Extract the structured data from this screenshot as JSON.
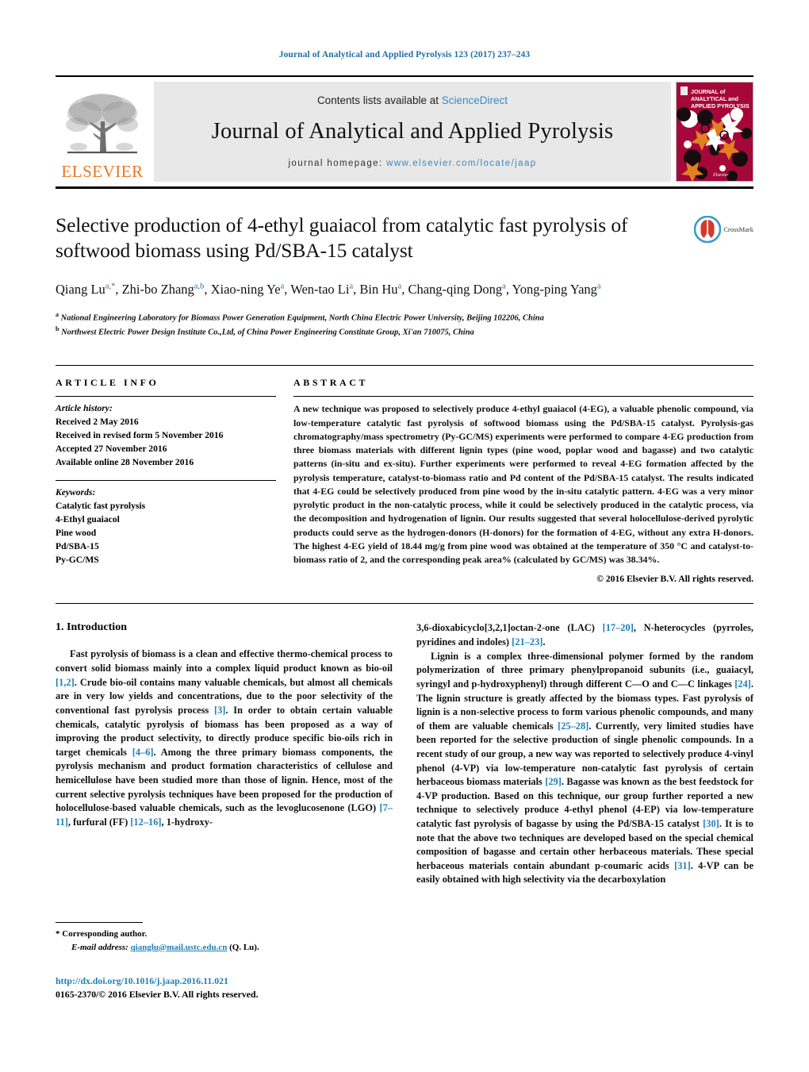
{
  "running_head": "Journal of Analytical and Applied Pyrolysis 123 (2017) 237–243",
  "masthead": {
    "publisher": "ELSEVIER",
    "contents_prefix": "Contents lists available at ",
    "contents_link": "ScienceDirect",
    "journal_title": "Journal of Analytical and Applied Pyrolysis",
    "homepage_prefix": "journal homepage: ",
    "homepage_url": "www.elsevier.com/locate/jaap",
    "cover_line1": "JOURNAL of",
    "cover_line2": "ANALYTICAL and",
    "cover_line3": "APPLIED PYROLYSIS",
    "cover_footer": "Elsevier"
  },
  "article": {
    "title": "Selective production of 4-ethyl guaiacol from catalytic fast pyrolysis of softwood biomass using Pd/SBA-15 catalyst",
    "crossmark_label": "CrossMark",
    "authors_html": "Qiang Lu<sup>a,*</sup>, Zhi-bo Zhang<sup>a,b</sup>, Xiao-ning Ye<sup>a</sup>, Wen-tao Li<sup>a</sup>, Bin Hu<sup>a</sup>, Chang-qing Dong<sup>a</sup>, Yong-ping Yang<sup>a</sup>",
    "affiliation_a": "National Engineering Laboratory for Biomass Power Generation Equipment, North China Electric Power University, Beijing 102206, China",
    "affiliation_b": "Northwest Electric Power Design Institute Co.,Ltd, of China Power Engineering Constitute Group, Xi'an 710075, China"
  },
  "info": {
    "heading": "ARTICLE INFO",
    "history_label": "Article history:",
    "history": [
      "Received 2 May 2016",
      "Received in revised form 5 November 2016",
      "Accepted 27 November 2016",
      "Available online 28 November 2016"
    ],
    "keywords_label": "Keywords:",
    "keywords": [
      "Catalytic fast pyrolysis",
      "4-Ethyl guaiacol",
      "Pine wood",
      "Pd/SBA-15",
      "Py-GC/MS"
    ]
  },
  "abstract": {
    "heading": "ABSTRACT",
    "text": "A new technique was proposed to selectively produce 4-ethyl guaiacol (4-EG), a valuable phenolic compound, via low-temperature catalytic fast pyrolysis of softwood biomass using the Pd/SBA-15 catalyst. Pyrolysis-gas chromatography/mass spectrometry (Py-GC/MS) experiments were performed to compare 4-EG production from three biomass materials with different lignin types (pine wood, poplar wood and bagasse) and two catalytic patterns (in-situ and ex-situ). Further experiments were performed to reveal 4-EG formation affected by the pyrolysis temperature, catalyst-to-biomass ratio and Pd content of the Pd/SBA-15 catalyst. The results indicated that 4-EG could be selectively produced from pine wood by the in-situ catalytic pattern. 4-EG was a very minor pyrolytic product in the non-catalytic process, while it could be selectively produced in the catalytic process, via the decomposition and hydrogenation of lignin. Our results suggested that several holocellulose-derived pyrolytic products could serve as the hydrogen-donors (H-donors) for the formation of 4-EG, without any extra H-donors. The highest 4-EG yield of 18.44 mg/g from pine wood was obtained at the temperature of 350 °C and catalyst-to-biomass ratio of 2, and the corresponding peak area% (calculated by GC/MS) was 38.34%.",
    "copyright": "© 2016 Elsevier B.V. All rights reserved."
  },
  "body": {
    "section_number_title": "1.  Introduction",
    "left_paragraph_1_html": "Fast pyrolysis of biomass is a clean and effective thermo-chemical process to convert solid biomass mainly into a complex liquid product known as bio-oil <span class=\"ref\">[1,2]</span>. Crude bio-oil contains many valuable chemicals, but almost all chemicals are in very low yields and concentrations, due to the poor selectivity of the conventional fast pyrolysis process <span class=\"ref\">[3]</span>. In order to obtain certain valuable chemicals, catalytic pyrolysis of biomass has been proposed as a way of improving the product selectivity, to directly produce specific bio-oils rich in target chemicals <span class=\"ref\">[4–6]</span>. Among the three primary biomass components, the pyrolysis mechanism and product formation characteristics of cellulose and hemicellulose have been studied more than those of lignin. Hence, most of the current selective pyrolysis techniques have been proposed for the production of holocellulose-based valuable chemicals, such as the levoglucosenone (LGO) <span class=\"ref\">[7–11]</span>, furfural (FF) <span class=\"ref\">[12–16]</span>, 1-hydroxy-",
    "right_paragraph_1_html": "3,6-dioxabicyclo[3,2,1]octan-2-one (LAC) <span class=\"ref\">[17–20]</span>, N-heterocycles (pyrroles, pyridines and indoles) <span class=\"ref\">[21–23]</span>.",
    "right_paragraph_2_html": "Lignin is a complex three-dimensional polymer formed by the random polymerization of three primary phenylpropanoid subunits (i.e., guaiacyl, syringyl and p-hydroxyphenyl) through different C—O and C—C linkages <span class=\"ref\">[24]</span>. The lignin structure is greatly affected by the biomass types. Fast pyrolysis of lignin is a non-selective process to form various phenolic compounds, and many of them are valuable chemicals <span class=\"ref\">[25–28]</span>. Currently, very limited studies have been reported for the selective production of single phenolic compounds. In a recent study of our group, a new way was reported to selectively produce 4-vinyl phenol (4-VP) via low-temperature non-catalytic fast pyrolysis of certain herbaceous biomass materials <span class=\"ref\">[29]</span>. Bagasse was known as the best feedstock for 4-VP production. Based on this technique, our group further reported a new technique to selectively produce 4-ethyl phenol (4-EP) via low-temperature catalytic fast pyrolysis of bagasse by using the Pd/SBA-15 catalyst <span class=\"ref\">[30]</span>. It is to note that the above two techniques are developed based on the special chemical composition of bagasse and certain other herbaceous materials. These special herbaceous materials contain abundant p-coumaric acids <span class=\"ref\">[31]</span>. 4-VP can be easily obtained with high selectivity via the decarboxylation"
  },
  "footnote": {
    "corresponding": "*  Corresponding author.",
    "email_label": "E-mail address: ",
    "email": "qianglu@mail.ustc.edu.cn",
    "email_suffix": " (Q. Lu)."
  },
  "footer": {
    "doi": "http://dx.doi.org/10.1016/j.jaap.2016.11.021",
    "issn": "0165-2370/© 2016 Elsevier B.V. All rights reserved."
  },
  "colors": {
    "link_blue": "#1f7fb5",
    "header_blue": "#1f6fa8",
    "elsevier_orange": "#E87722",
    "cover_red": "#a5073a",
    "band_gray": "#e8e8e8"
  }
}
